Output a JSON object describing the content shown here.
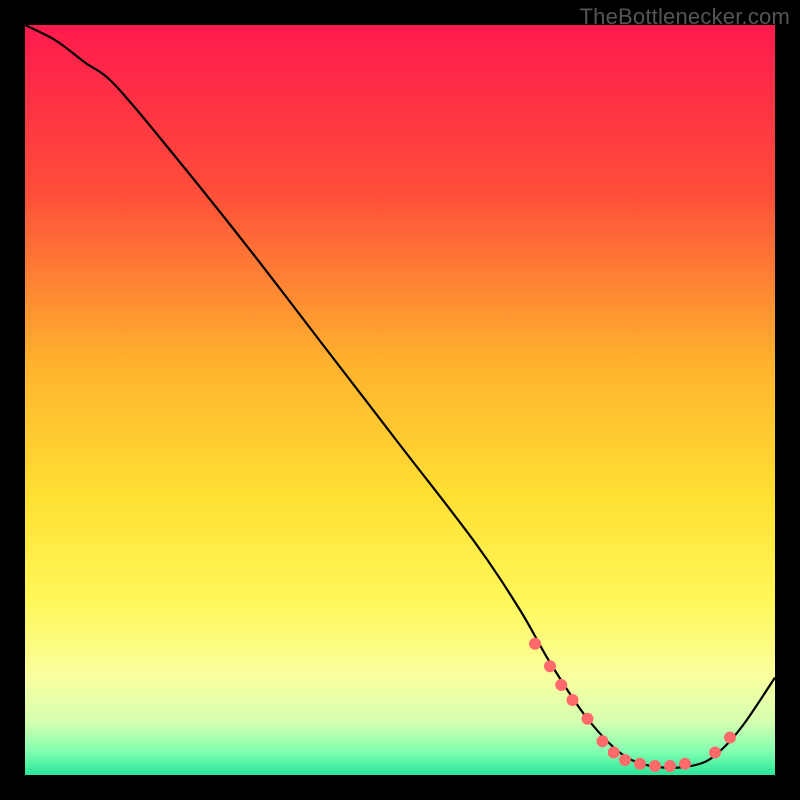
{
  "watermark": "TheBottlenecker.com",
  "chart_data": {
    "type": "line",
    "title": "",
    "xlabel": "",
    "ylabel": "",
    "xlim": [
      0,
      100
    ],
    "ylim": [
      0,
      100
    ],
    "background_gradient_stops": [
      {
        "offset": 0,
        "color": "#ff1a4d"
      },
      {
        "offset": 0.22,
        "color": "#ff4d3a"
      },
      {
        "offset": 0.45,
        "color": "#ffb22e"
      },
      {
        "offset": 0.63,
        "color": "#ffe033"
      },
      {
        "offset": 0.77,
        "color": "#fff85a"
      },
      {
        "offset": 0.87,
        "color": "#f9ffa0"
      },
      {
        "offset": 0.93,
        "color": "#d4ffb0"
      },
      {
        "offset": 0.97,
        "color": "#7fffb0"
      },
      {
        "offset": 1.0,
        "color": "#28e59a"
      }
    ],
    "series": [
      {
        "name": "bottleneck-curve",
        "color": "#000000",
        "x": [
          0,
          4,
          8,
          12,
          20,
          30,
          40,
          50,
          60,
          66,
          70,
          75,
          80,
          85,
          90,
          93,
          96,
          100
        ],
        "y": [
          100,
          98,
          95,
          92,
          82.5,
          70,
          57,
          44,
          31,
          22,
          15,
          7.5,
          2.5,
          1,
          1.5,
          3.5,
          7,
          13
        ]
      }
    ],
    "markers": {
      "name": "highlight-dots",
      "color": "#ff6b6b",
      "radius": 6,
      "points": [
        {
          "x": 68,
          "y": 17.5
        },
        {
          "x": 70,
          "y": 14.5
        },
        {
          "x": 71.5,
          "y": 12
        },
        {
          "x": 73,
          "y": 10
        },
        {
          "x": 75,
          "y": 7.5
        },
        {
          "x": 77,
          "y": 4.5
        },
        {
          "x": 78.5,
          "y": 3
        },
        {
          "x": 80,
          "y": 2
        },
        {
          "x": 82,
          "y": 1.5
        },
        {
          "x": 84,
          "y": 1.2
        },
        {
          "x": 86,
          "y": 1.2
        },
        {
          "x": 88,
          "y": 1.5
        },
        {
          "x": 92,
          "y": 3
        },
        {
          "x": 94,
          "y": 5
        }
      ]
    }
  }
}
